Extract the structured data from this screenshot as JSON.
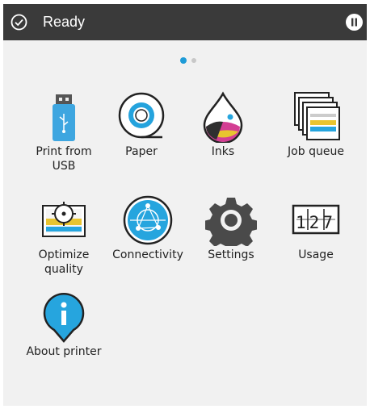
{
  "status": {
    "text": "Ready",
    "check_icon": "checkmark-circle-icon",
    "pause_icon": "pause-icon"
  },
  "pager": {
    "pages": 2,
    "current": 1
  },
  "tiles": [
    {
      "label": "Print from\nUSB",
      "icon": "usb-icon"
    },
    {
      "label": "Paper",
      "icon": "paper-roll-icon"
    },
    {
      "label": "Inks",
      "icon": "ink-drop-icon"
    },
    {
      "label": "Job queue",
      "icon": "job-queue-icon"
    },
    {
      "label": "Optimize\nquality",
      "icon": "optimize-quality-icon"
    },
    {
      "label": "Connectivity",
      "icon": "globe-icon"
    },
    {
      "label": "Settings",
      "icon": "gear-icon"
    },
    {
      "label": "Usage",
      "icon": "counter-icon"
    },
    {
      "label": "About printer",
      "icon": "info-icon"
    }
  ],
  "usage_counter": "127",
  "colors": {
    "status_bar": "#3a3a3a",
    "accent": "#1e9bd7",
    "panel": "#f1f1f1"
  }
}
